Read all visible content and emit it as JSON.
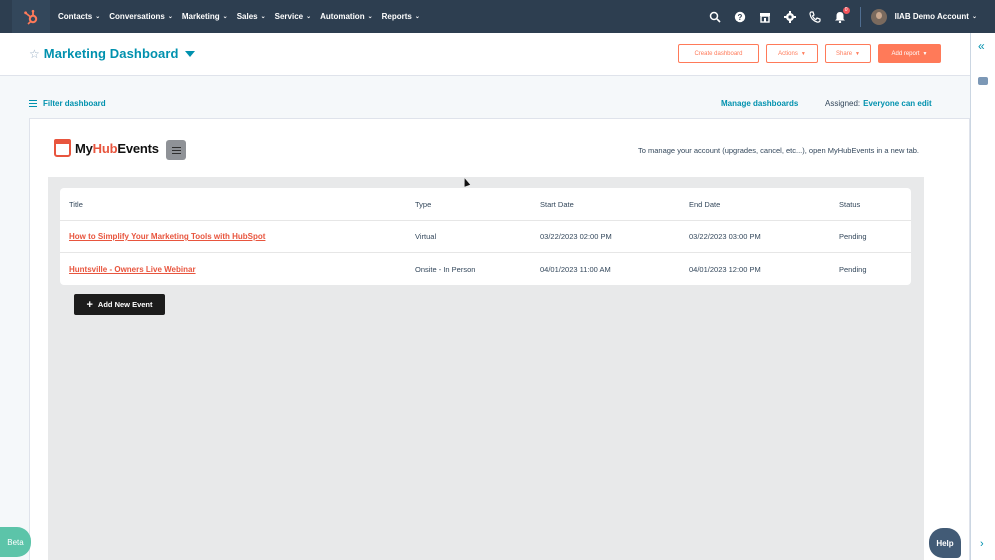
{
  "nav": {
    "items": [
      {
        "label": "Contacts"
      },
      {
        "label": "Conversations"
      },
      {
        "label": "Marketing"
      },
      {
        "label": "Sales"
      },
      {
        "label": "Service"
      },
      {
        "label": "Automation"
      },
      {
        "label": "Reports"
      }
    ],
    "notification_count": "0",
    "account_name": "IIAB Demo Account",
    "icons": [
      "search-icon",
      "help-icon",
      "marketplace-icon",
      "settings-icon",
      "calling-icon",
      "notifications-icon"
    ]
  },
  "header": {
    "title": "Marketing Dashboard",
    "create_label": "Create dashboard",
    "actions_label": "Actions",
    "share_label": "Share",
    "add_report_label": "Add report"
  },
  "filter": {
    "label": "Filter dashboard",
    "manage_label": "Manage dashboards",
    "assigned_label": "Assigned:",
    "assigned_value": "Everyone can edit"
  },
  "card": {
    "logo_prefix": "My",
    "logo_hub": "Hub",
    "logo_suffix": "Events",
    "manage_note": "To manage your account (upgrades, cancel, etc...), open MyHubEvents in a new tab.",
    "table": {
      "headers": {
        "title": "Title",
        "type": "Type",
        "start": "Start Date",
        "end": "End Date",
        "status": "Status"
      },
      "rows": [
        {
          "title": "How to Simplify Your Marketing Tools with HubSpot",
          "type": "Virtual",
          "start": "03/22/2023 02:00 PM",
          "end": "03/22/2023 03:00 PM",
          "status": "Pending"
        },
        {
          "title": "Huntsville - Owners Live Webinar",
          "type": "Onsite - In Person",
          "start": "04/01/2023 11:00 AM",
          "end": "04/01/2023 12:00 PM",
          "status": "Pending"
        }
      ]
    },
    "add_event_label": "Add New Event"
  },
  "floating": {
    "beta_label": "Beta",
    "help_label": "Help"
  },
  "colors": {
    "nav_bg": "#2d3e50",
    "accent": "#ff7a59",
    "link": "#0091ae",
    "brand_red": "#e8553e"
  }
}
